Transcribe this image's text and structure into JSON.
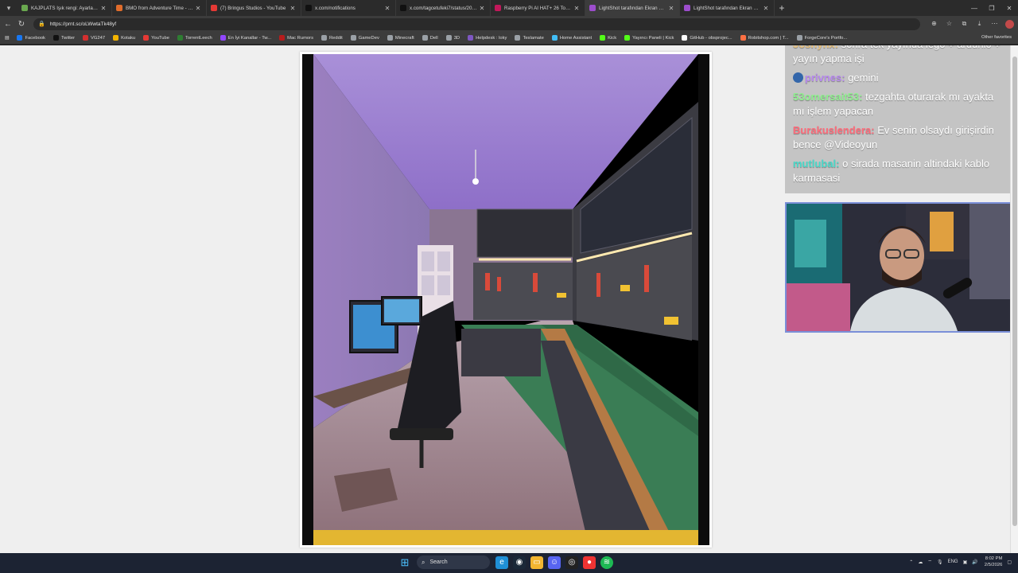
{
  "tabs": [
    {
      "label": "KAJPLATS Işık rengi: Ayarlanabilir...",
      "color": "#6aa84f"
    },
    {
      "label": "BMO from Adventure Time - Local...",
      "color": "#e06c2b"
    },
    {
      "label": "(7) Bringus Studios - YouTube",
      "color": "#e53935"
    },
    {
      "label": "x.com/notifications",
      "color": "#111111"
    },
    {
      "label": "x.com/tagcetufeki7/status/20194...",
      "color": "#111111"
    },
    {
      "label": "Raspberry Pi AI HAT+ 26 Tops | SA...",
      "color": "#c2185b"
    },
    {
      "label": "LightShot tarafından Ekran Görünt...",
      "color": "#9c4dcc",
      "active": true
    },
    {
      "label": "LightShot tarafından Ekran Görünt...",
      "color": "#9c4dcc"
    }
  ],
  "address": {
    "url": "https://prnt.sc/oLWwtaTk48yf"
  },
  "bookmarks": [
    {
      "label": "Facebook",
      "color": "#1877f2"
    },
    {
      "label": "Twitter",
      "color": "#111111"
    },
    {
      "label": "VG247",
      "color": "#d32f2f"
    },
    {
      "label": "Kotaku",
      "color": "#f4b400"
    },
    {
      "label": "YouTube",
      "color": "#e53935"
    },
    {
      "label": "TorrentLeech",
      "color": "#2e7d32"
    },
    {
      "label": "En İyi Kanallar - Tw...",
      "color": "#9146ff"
    },
    {
      "label": "Mac Rumors",
      "color": "#b71c1c"
    },
    {
      "label": "Reddit",
      "color": "#9aa0a6"
    },
    {
      "label": "GameDev",
      "color": "#9aa0a6"
    },
    {
      "label": "Minecraft",
      "color": "#9aa0a6"
    },
    {
      "label": "Dell",
      "color": "#9aa0a6"
    },
    {
      "label": "3D",
      "color": "#9aa0a6"
    },
    {
      "label": "Helpdesk : loky",
      "color": "#7e57c2"
    },
    {
      "label": "Teslamate",
      "color": "#9aa0a6"
    },
    {
      "label": "Home Assistant",
      "color": "#41bdf5"
    },
    {
      "label": "Kick",
      "color": "#53fc18"
    },
    {
      "label": "Yayıncı Paneli | Kick",
      "color": "#53fc18"
    },
    {
      "label": "GitHub - obsprojec...",
      "color": "#ffffff"
    },
    {
      "label": "Robitshop.com | T...",
      "color": "#ff7043"
    },
    {
      "label": "ForgeCore's Portfo...",
      "color": "#9aa0a6"
    }
  ],
  "bookmarks_other": "Other favorites",
  "chat": [
    {
      "user": "Joshynx:",
      "color": "#e8c07a",
      "text": "sonra tek yayında lego + ardunio + yayın yapma işi"
    },
    {
      "user": "privnes:",
      "color": "#b889ef",
      "text": "gemini",
      "badge": true
    },
    {
      "user": "53omersait53:",
      "color": "#8ff08f",
      "text": "tezgahta oturarak mı ayakta mı işlem yapacan"
    },
    {
      "user": "Burakuslendera:",
      "color": "#ff6b7a",
      "text": "Ev senin olsaydı girişirdin bence @Videoyun"
    },
    {
      "user": "mutlubal:",
      "color": "#4ad9c9",
      "text": "o sirada masanin altindaki kablo karmasasi"
    }
  ],
  "taskbar": {
    "search_placeholder": "Search",
    "lang": "ENG",
    "time": "8:02 PM",
    "date": "2/5/2026"
  }
}
